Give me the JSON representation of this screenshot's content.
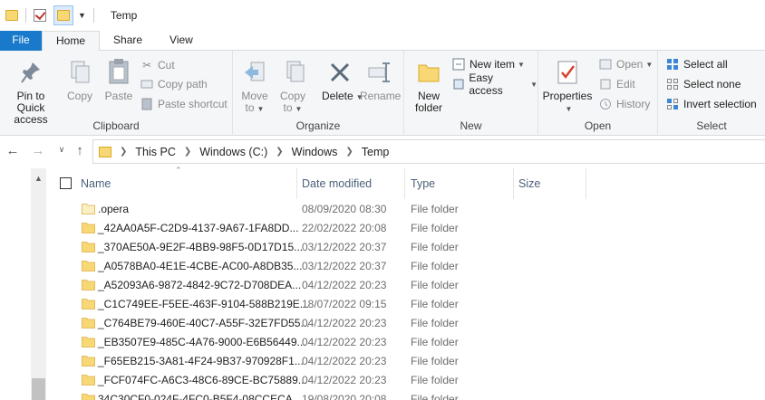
{
  "window": {
    "title": "Temp"
  },
  "ribbon_tabs": [
    "File",
    "Home",
    "Share",
    "View"
  ],
  "clipboard": {
    "pin_label": "Pin to Quick access",
    "copy_label": "Copy",
    "paste_label": "Paste",
    "cut_label": "Cut",
    "copy_path_label": "Copy path",
    "paste_shortcut_label": "Paste shortcut",
    "group_label": "Clipboard"
  },
  "organize": {
    "move_to_label": "Move to",
    "copy_to_label": "Copy to",
    "delete_label": "Delete",
    "rename_label": "Rename",
    "group_label": "Organize"
  },
  "new_group": {
    "new_folder_label": "New folder",
    "new_item_label": "New item",
    "easy_access_label": "Easy access",
    "group_label": "New"
  },
  "open_group": {
    "properties_label": "Properties",
    "open_label": "Open",
    "edit_label": "Edit",
    "history_label": "History",
    "group_label": "Open"
  },
  "select_group": {
    "select_all_label": "Select all",
    "select_none_label": "Select none",
    "invert_label": "Invert selection",
    "group_label": "Select"
  },
  "breadcrumb": [
    "This PC",
    "Windows (C:)",
    "Windows",
    "Temp"
  ],
  "columns": {
    "name": "Name",
    "date": "Date modified",
    "type": "Type",
    "size": "Size"
  },
  "files": [
    {
      "name": ".opera",
      "date": "08/09/2020 08:30",
      "type": "File folder",
      "light": true
    },
    {
      "name": "_42AA0A5F-C2D9-4137-9A67-1FA8DD...",
      "date": "22/02/2022 20:08",
      "type": "File folder"
    },
    {
      "name": "_370AE50A-9E2F-4BB9-98F5-0D17D15...",
      "date": "03/12/2022 20:37",
      "type": "File folder"
    },
    {
      "name": "_A0578BA0-4E1E-4CBE-AC00-A8DB35...",
      "date": "03/12/2022 20:37",
      "type": "File folder"
    },
    {
      "name": "_A52093A6-9872-4842-9C72-D708DEA...",
      "date": "04/12/2022 20:23",
      "type": "File folder"
    },
    {
      "name": "_C1C749EE-F5EE-463F-9104-588B219E...",
      "date": "18/07/2022 09:15",
      "type": "File folder"
    },
    {
      "name": "_C764BE79-460E-40C7-A55F-32E7FD55...",
      "date": "04/12/2022 20:23",
      "type": "File folder"
    },
    {
      "name": "_EB3507E9-485C-4A76-9000-E6B56449...",
      "date": "04/12/2022 20:23",
      "type": "File folder"
    },
    {
      "name": "_F65EB215-3A81-4F24-9B37-970928F1...",
      "date": "04/12/2022 20:23",
      "type": "File folder"
    },
    {
      "name": "_FCF074FC-A6C3-48C6-89CE-BC75889...",
      "date": "04/12/2022 20:23",
      "type": "File folder"
    },
    {
      "name": "34C30CF0-024F-4FC0-B5F4-08CCECA...",
      "date": "19/08/2020 20:08",
      "type": "File folder"
    }
  ],
  "colors": {
    "file_tab": "#1979ca",
    "folder": "#f8d775",
    "accent": "#0063b1"
  }
}
